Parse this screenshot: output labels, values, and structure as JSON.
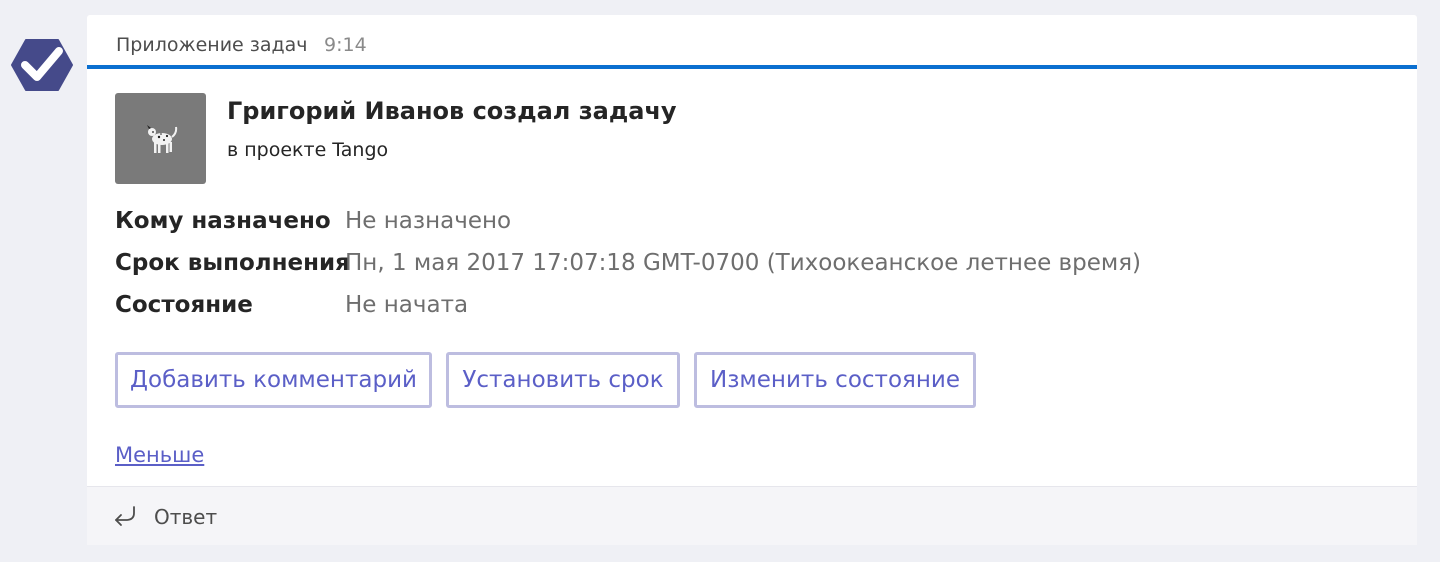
{
  "message": {
    "sender": "Приложение задач",
    "time": "9:14",
    "app_icon": "checkmark-hexagon-icon",
    "accent_color": "#0a6fd0"
  },
  "card": {
    "thumbnail_icon": "dalmatian-dog-icon",
    "title": "Григорий Иванов создал задачу",
    "subtitle": "в проекте Tango",
    "facts": [
      {
        "label": "Кому назначено",
        "value": "Не назначено"
      },
      {
        "label": "Срок выполнения",
        "value": "Пн, 1 мая 2017 17:07:18 GMT-0700 (Тихоокеанское летнее время)"
      },
      {
        "label": "Состояние",
        "value": "Не начата"
      }
    ],
    "actions": [
      {
        "label": "Добавить комментарий"
      },
      {
        "label": "Установить срок"
      },
      {
        "label": "Изменить состояние"
      }
    ],
    "toggle_label": "Меньше"
  },
  "reply": {
    "icon": "reply-arrow-icon",
    "label": "Ответ"
  }
}
